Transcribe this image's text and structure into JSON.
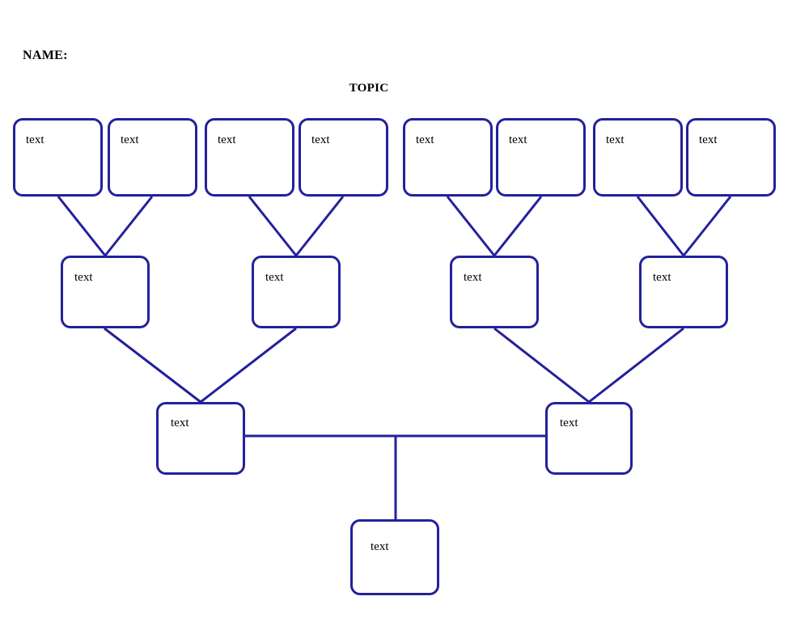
{
  "header": {
    "name_label": "NAME:",
    "topic_label": "TOPIC"
  },
  "theme": {
    "box_border_color": "#23219b",
    "line_color": "#23219b",
    "background_color": "#ffffff",
    "text_color": "#000000"
  },
  "tree": {
    "generation_top": [
      {
        "label": "text"
      },
      {
        "label": "text"
      },
      {
        "label": "text"
      },
      {
        "label": "text"
      },
      {
        "label": "text"
      },
      {
        "label": "text"
      },
      {
        "label": "text"
      },
      {
        "label": "text"
      }
    ],
    "generation_middle": [
      {
        "label": "text"
      },
      {
        "label": "text"
      },
      {
        "label": "text"
      },
      {
        "label": "text"
      }
    ],
    "generation_parents": [
      {
        "label": "text"
      },
      {
        "label": "text"
      }
    ],
    "generation_child": [
      {
        "label": "text"
      }
    ]
  }
}
